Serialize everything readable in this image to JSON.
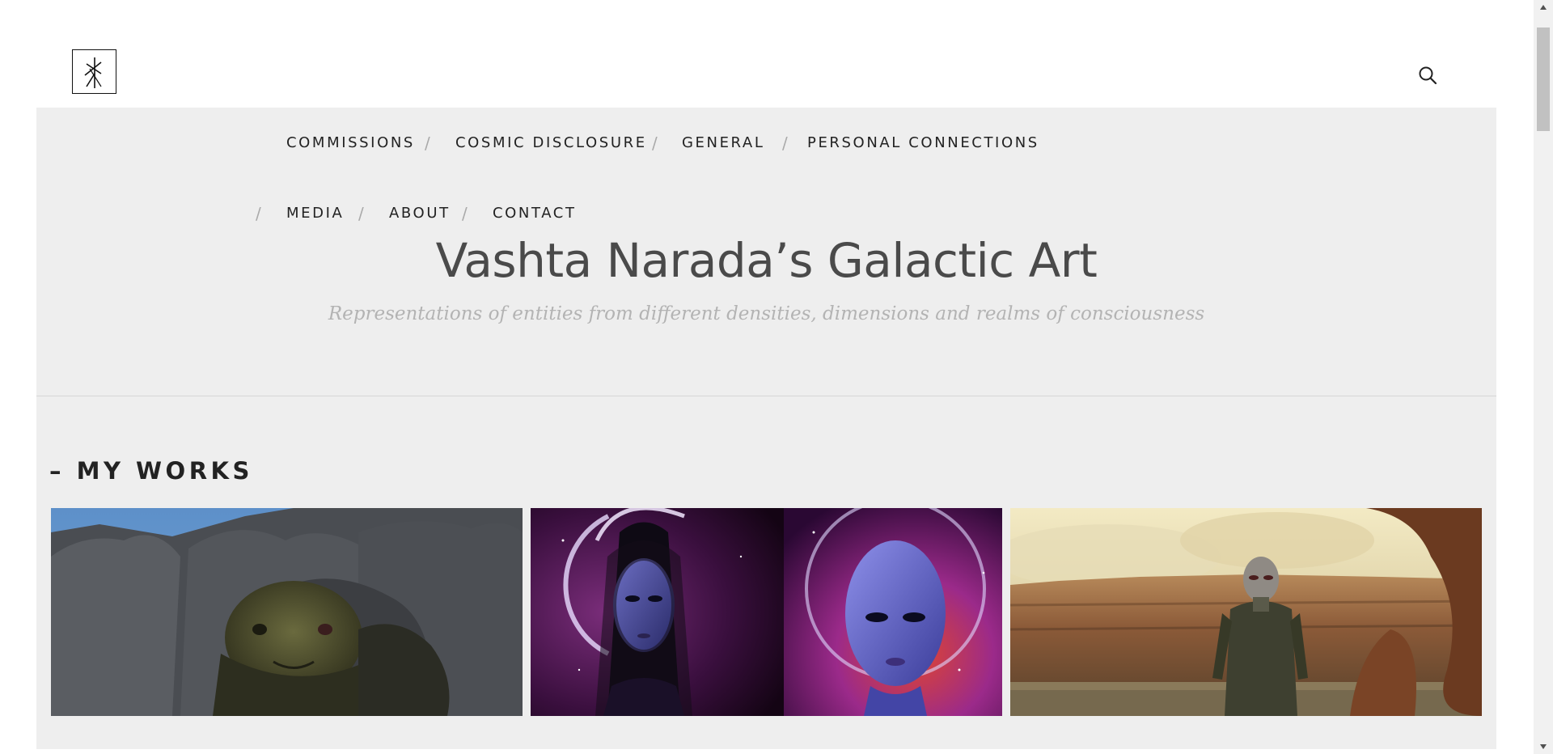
{
  "header": {
    "logo_icon": "rune-logo-icon",
    "search_icon": "search-icon"
  },
  "nav": {
    "items": [
      {
        "label": "COMMISSIONS"
      },
      {
        "label": "COSMIC DISCLOSURE"
      },
      {
        "label": "GENERAL"
      },
      {
        "label": "PERSONAL CONNECTIONS"
      },
      {
        "label": "MEDIA"
      },
      {
        "label": "ABOUT"
      },
      {
        "label": "CONTACT"
      }
    ],
    "separator": "/"
  },
  "site": {
    "title": "Vashta Narada’s Galactic Art",
    "tagline": "Representations of entities from different densities, dimensions and realms of consciousness"
  },
  "works_section": {
    "title": "– MY WORKS",
    "items": [
      {
        "name": "reptilian-artwork"
      },
      {
        "name": "blue-beings-artwork"
      },
      {
        "name": "canyon-being-artwork"
      }
    ]
  },
  "colors": {
    "panel_bg": "#eeeeee",
    "title": "#4a4a4a",
    "tagline": "#b3b3b3",
    "nav_text": "#222222"
  }
}
